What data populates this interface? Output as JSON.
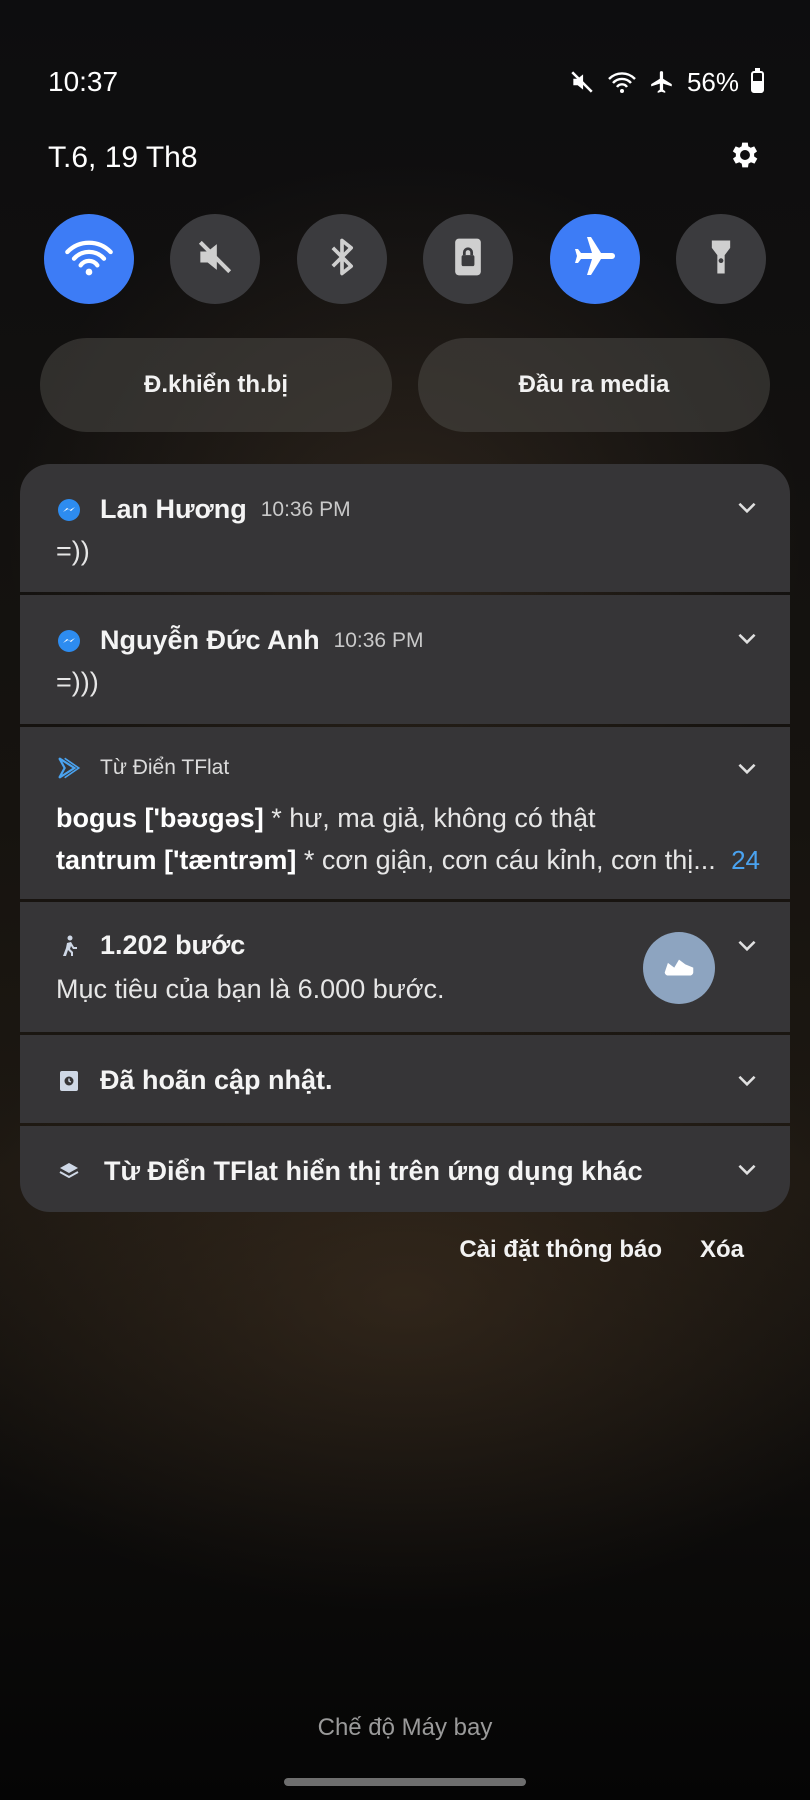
{
  "status_bar": {
    "time": "10:37",
    "icons": [
      "mute-icon",
      "wifi-icon",
      "airplane-icon"
    ],
    "battery_percent": "56%",
    "battery_level": 0.56
  },
  "header": {
    "date": "T.6, 19 Th8",
    "settings_icon": "gear-icon"
  },
  "quick_settings": [
    {
      "name": "wifi",
      "icon": "wifi-icon",
      "on": true
    },
    {
      "name": "sound",
      "icon": "mute-icon",
      "on": false
    },
    {
      "name": "bluetooth",
      "icon": "bluetooth-icon",
      "on": false
    },
    {
      "name": "rotation-lock",
      "icon": "lock-icon",
      "on": false
    },
    {
      "name": "airplane",
      "icon": "airplane-icon",
      "on": true
    },
    {
      "name": "flashlight",
      "icon": "flashlight-icon",
      "on": false
    }
  ],
  "pills": {
    "device_control": "Đ.khiển th.bị",
    "media_output": "Đầu ra media"
  },
  "notifications": {
    "n1": {
      "title": "Lan Hương",
      "time": "10:36 PM",
      "body": "=))",
      "icon": "messenger-icon"
    },
    "n2": {
      "title": "Nguyễn Đức Anh",
      "time": "10:36 PM",
      "body": "=)))",
      "icon": "messenger-icon"
    },
    "n3": {
      "app": "Từ Điển TFlat",
      "icon": "tflat-icon",
      "line1_word": "bogus ['bəʊgəs]",
      "line1_def": " * hư, ma giả, không có thật",
      "line2_word": "tantrum ['tæntrəm]",
      "line2_def": " * cơn giận, cơn cáu kỉnh, cơn thị...",
      "count": "24"
    },
    "n4": {
      "title": "1.202 bước",
      "body": "Mục tiêu của bạn là 6.000 bước.",
      "icon": "walking-icon",
      "action_icon": "shoe-icon"
    },
    "n5": {
      "title": "Đã hoãn cập nhật.",
      "icon": "update-icon"
    },
    "n6": {
      "title": "Từ Điển TFlat hiển thị trên ứng dụng khác",
      "icon": "layers-icon"
    }
  },
  "actions": {
    "settings": "Cài đặt thông báo",
    "clear": "Xóa"
  },
  "bottom_label": "Chế độ Máy bay",
  "colors": {
    "accent": "#3d7cf6",
    "card": "#363537",
    "link": "#4aa3f0"
  }
}
